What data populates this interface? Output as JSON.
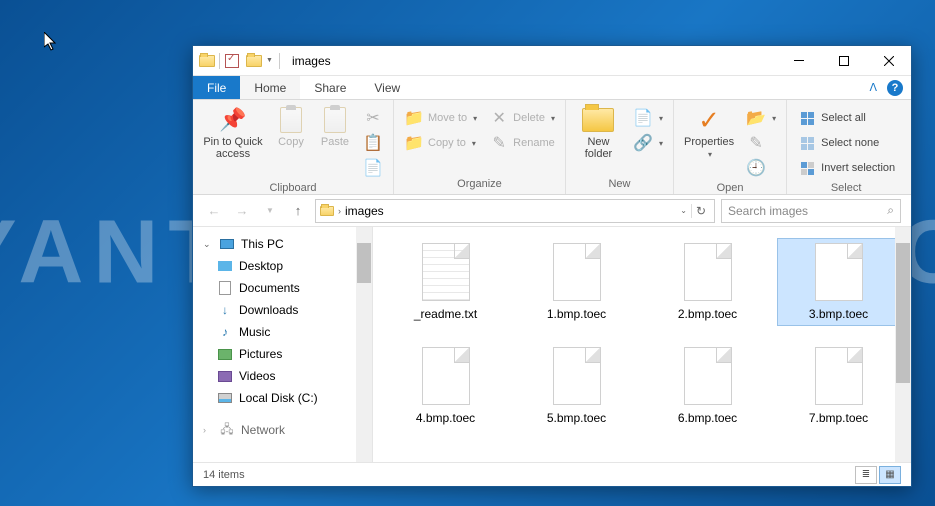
{
  "window": {
    "title": "images",
    "tabs": {
      "file": "File",
      "home": "Home",
      "share": "Share",
      "view": "View"
    }
  },
  "ribbon": {
    "clipboard": {
      "label": "Clipboard",
      "pin": "Pin to Quick access",
      "copy": "Copy",
      "paste": "Paste"
    },
    "organize": {
      "label": "Organize",
      "moveto": "Move to",
      "copyto": "Copy to",
      "delete": "Delete",
      "rename": "Rename"
    },
    "new": {
      "label": "New",
      "newfolder": "New folder"
    },
    "open": {
      "label": "Open",
      "properties": "Properties"
    },
    "select": {
      "label": "Select",
      "all": "Select all",
      "none": "Select none",
      "invert": "Invert selection"
    }
  },
  "address": {
    "path": "images",
    "search_placeholder": "Search images"
  },
  "sidebar": {
    "thispc": "This PC",
    "items": [
      {
        "label": "Desktop"
      },
      {
        "label": "Documents"
      },
      {
        "label": "Downloads"
      },
      {
        "label": "Music"
      },
      {
        "label": "Pictures"
      },
      {
        "label": "Videos"
      },
      {
        "label": "Local Disk (C:)"
      },
      {
        "label": "Network"
      }
    ]
  },
  "files": [
    {
      "name": "_readme.txt",
      "type": "txt"
    },
    {
      "name": "1.bmp.toec",
      "type": "file"
    },
    {
      "name": "2.bmp.toec",
      "type": "file"
    },
    {
      "name": "3.bmp.toec",
      "type": "file",
      "selected": true
    },
    {
      "name": "4.bmp.toec",
      "type": "file"
    },
    {
      "name": "5.bmp.toec",
      "type": "file"
    },
    {
      "name": "6.bmp.toec",
      "type": "file"
    },
    {
      "name": "7.bmp.toec",
      "type": "file"
    }
  ],
  "status": {
    "count": "14 items"
  },
  "watermark": "MYANTISPYWARE.COM"
}
